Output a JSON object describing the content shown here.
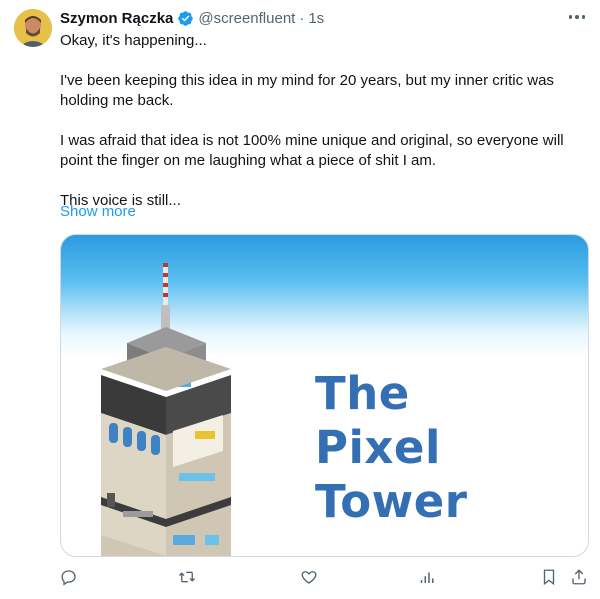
{
  "author": {
    "name": "Szymon Rączka",
    "handle": "@screenfluent",
    "separator": "·",
    "time": "1s",
    "verified_color": "#1d9bf0"
  },
  "tweet": {
    "paragraphs": [
      "Okay, it's happening...",
      "I've been keeping this idea in my mind for 20 years, but my inner critic was holding me back.",
      "I was afraid that idea is not 100% mine unique and original, so everyone will point the finger on me laughing what a piece of shit I am.",
      "This voice is still..."
    ],
    "show_more": "Show more"
  },
  "media": {
    "title_lines": [
      "The",
      "Pixel",
      "Tower"
    ],
    "title_color": "#336fb2"
  },
  "actions": {
    "icons": [
      "reply-icon",
      "retweet-icon",
      "like-icon",
      "views-icon",
      "bookmark-icon",
      "share-icon"
    ]
  }
}
